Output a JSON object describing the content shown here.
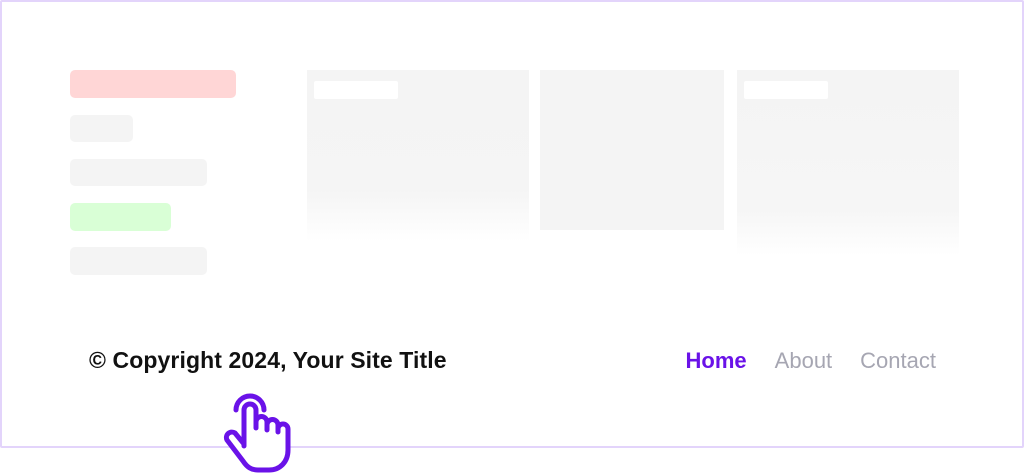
{
  "footer": {
    "copyright": "© Copyright 2024, Your Site Title"
  },
  "nav": {
    "items": [
      {
        "label": "Home",
        "active": true
      },
      {
        "label": "About",
        "active": false
      },
      {
        "label": "Contact",
        "active": false
      }
    ]
  },
  "colors": {
    "accent": "#6a12e8",
    "nav_inactive": "#a6a6b2",
    "frame_border": "#e3d4fb",
    "placeholder_red": "#ffd6d6",
    "placeholder_green": "#d9ffd6",
    "placeholder_gray": "#f4f4f4"
  },
  "icons": {
    "cursor": "hand-pointer-icon"
  }
}
